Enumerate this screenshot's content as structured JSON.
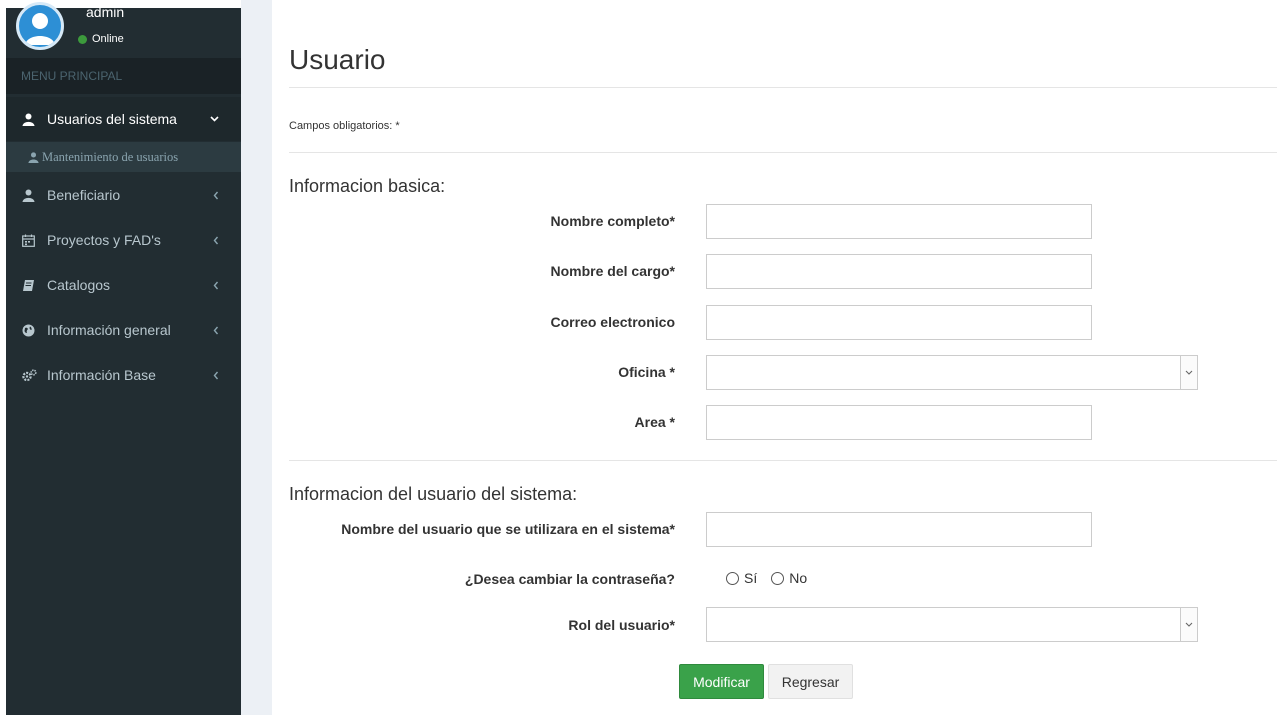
{
  "user": {
    "name": "admin",
    "status": "Online",
    "status_color": "#3c9a3c"
  },
  "sidebar": {
    "header": "MENU PRINCIPAL",
    "items": [
      {
        "label": "Usuarios del sistema",
        "icon": "user-icon",
        "chevron": "chevron-down-icon",
        "active": true
      },
      {
        "label": "Beneficiario",
        "icon": "user-icon",
        "chevron": "chevron-left-icon"
      },
      {
        "label": "Proyectos y FAD's",
        "icon": "calendar-icon",
        "chevron": "chevron-left-icon"
      },
      {
        "label": "Catalogos",
        "icon": "book-icon",
        "chevron": "chevron-left-icon"
      },
      {
        "label": "Información general",
        "icon": "globe-icon",
        "chevron": "chevron-left-icon"
      },
      {
        "label": "Información Base",
        "icon": "cogs-icon",
        "chevron": "chevron-left-icon"
      }
    ],
    "submenu": {
      "label": "Mantenimiento de usuarios",
      "icon": "user-icon"
    }
  },
  "page": {
    "title": "Usuario",
    "required_note": "Campos obligatorios: *",
    "section_basic": "Informacion basica:",
    "section_system": "Informacion del usuario del sistema:"
  },
  "form": {
    "full_name_label": "Nombre completo*",
    "full_name_value": "",
    "position_label": "Nombre del cargo*",
    "position_value": "",
    "email_label": "Correo electronico",
    "email_value": "",
    "office_label": "Oficina *",
    "office_value": "",
    "area_label": "Area *",
    "area_value": "",
    "username_label": "Nombre del usuario que se utilizara en el sistema*",
    "username_value": "",
    "change_password_label": "¿Desea cambiar la contraseña?",
    "change_password_yes": "Sí",
    "change_password_no": "No",
    "role_label": "Rol del usuario*",
    "role_value": ""
  },
  "buttons": {
    "submit": "Modificar",
    "back": "Regresar"
  },
  "colors": {
    "sidebar_bg": "#222d32",
    "primary_button": "#3aa24a",
    "avatar": "#2d8fd5"
  }
}
